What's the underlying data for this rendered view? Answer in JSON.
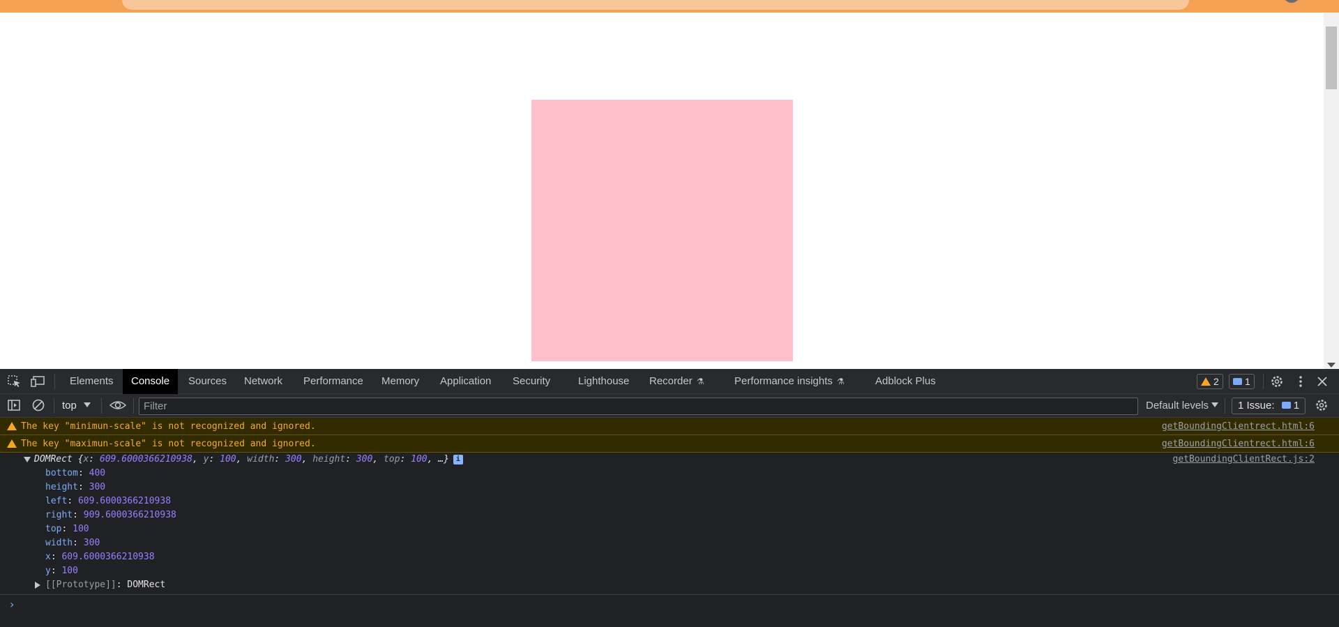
{
  "devtools": {
    "tabs": [
      "Elements",
      "Console",
      "Sources",
      "Network",
      "Performance",
      "Memory",
      "Application",
      "Security",
      "Lighthouse",
      "Recorder",
      "Performance insights",
      "Adblock Plus"
    ],
    "active_tab": "Console",
    "warnings_count": "2",
    "messages_count": "1",
    "icons": {
      "inspect": "inspect-element-icon",
      "device": "device-toolbar-icon",
      "settings": "gear-icon",
      "more": "kebab-menu-icon",
      "close": "close-icon",
      "experimental": "flask-icon"
    }
  },
  "console_toolbar": {
    "context": "top",
    "filter_placeholder": "Filter",
    "levels_label": "Default levels",
    "issues_label": "1 Issue:",
    "issues_count": "1"
  },
  "messages": [
    {
      "level": "warning",
      "text": "The key \"minimun-scale\" is not recognized and ignored.",
      "source": "getBoundingClientrect.html:6"
    },
    {
      "level": "warning",
      "text": "The key \"maximun-scale\" is not recognized and ignored.",
      "source": "getBoundingClientrect.html:6"
    }
  ],
  "object_log": {
    "type_name": "DOMRect",
    "summary": {
      "x": "609.6000366210938",
      "y": "100",
      "width": "300",
      "height": "300",
      "top": "100",
      "ellipsis": "…"
    },
    "source": "getBoundingClientRect.js:2",
    "properties": [
      {
        "key": "bottom",
        "value": "400"
      },
      {
        "key": "height",
        "value": "300"
      },
      {
        "key": "left",
        "value": "609.6000366210938"
      },
      {
        "key": "right",
        "value": "909.6000366210938"
      },
      {
        "key": "top",
        "value": "100"
      },
      {
        "key": "width",
        "value": "300"
      },
      {
        "key": "x",
        "value": "609.6000366210938"
      },
      {
        "key": "y",
        "value": "100"
      }
    ],
    "prototype_key": "[[Prototype]]",
    "prototype_value": "DOMRect"
  },
  "colors": {
    "page_box": "#ffc0cb",
    "chrome_frame": "#f5a153",
    "warning_text": "#f2ab26",
    "number": "#9980ff",
    "key": "#7cacf8"
  }
}
